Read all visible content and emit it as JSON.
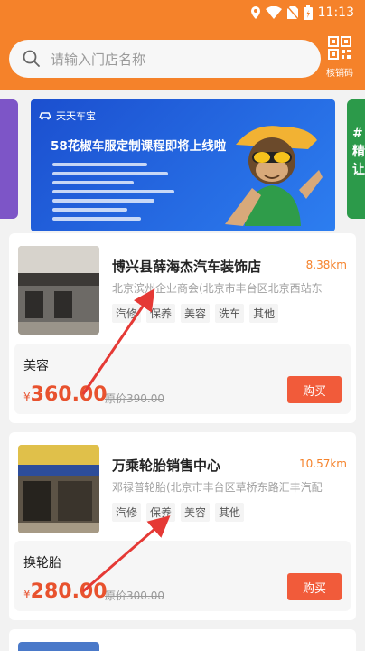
{
  "status": {
    "time": "11:13"
  },
  "search": {
    "placeholder": "请输入门店名称"
  },
  "scan": {
    "label": "核销码"
  },
  "banner": {
    "brand": "天天车宝",
    "title": "58花椒车服定制课程即将上线啦"
  },
  "side_right": {
    "text": "#\n精\n让"
  },
  "stores": [
    {
      "name": "博兴县薛海杰汽车装饰店",
      "distance": "8.38km",
      "address": "北京滨州企业商会(北京市丰台区北京西站东",
      "tags": [
        "汽修",
        "保养",
        "美容",
        "洗车",
        "其他"
      ],
      "deal": {
        "name": "美容",
        "yen": "¥",
        "price": "360.00",
        "original": "原价390.00",
        "buy": "购买"
      }
    },
    {
      "name": "万乘轮胎销售中心",
      "distance": "10.57km",
      "address": "邓禄普轮胎(北京市丰台区草桥东路汇丰汽配",
      "tags": [
        "汽修",
        "保养",
        "美容",
        "其他"
      ],
      "deal": {
        "name": "换轮胎",
        "yen": "¥",
        "price": "280.00",
        "original": "原价300.00",
        "buy": "购买"
      }
    }
  ],
  "colors": {
    "accent": "#f5822a",
    "price": "#e8522e",
    "button": "#f15b3a"
  }
}
